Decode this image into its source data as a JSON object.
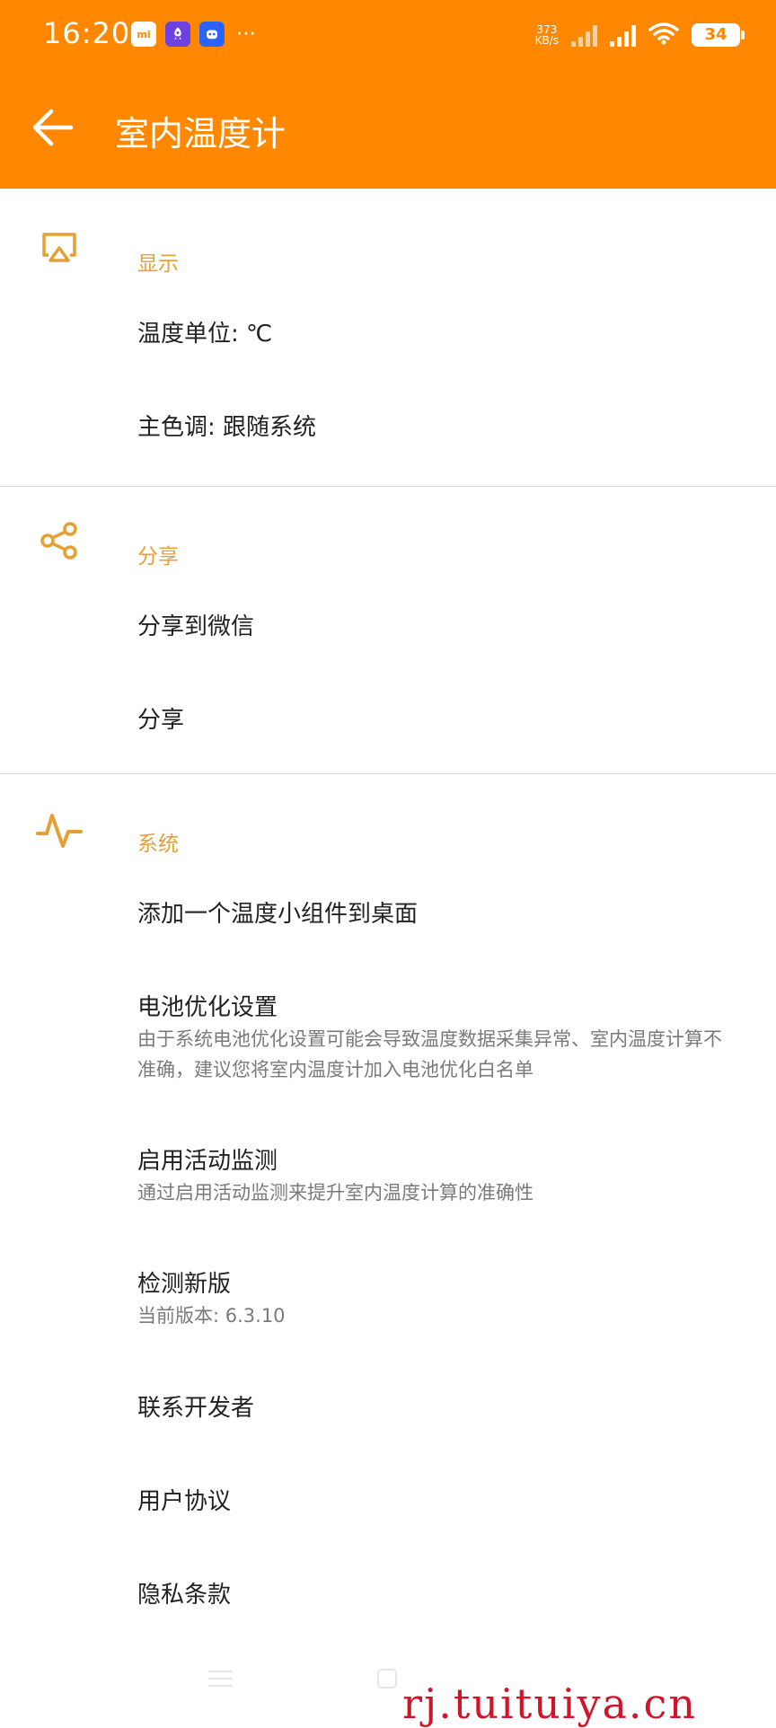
{
  "status_bar": {
    "time": "16:20",
    "netspeed_value": "373",
    "netspeed_unit": "KB/s",
    "battery": "34"
  },
  "toolbar": {
    "title": "室内温度计"
  },
  "sections": [
    {
      "title": "显示",
      "icon": "cast-icon",
      "items": [
        {
          "title": "温度单位: ℃"
        },
        {
          "title": "主色调: 跟随系统"
        }
      ]
    },
    {
      "title": "分享",
      "icon": "share-icon",
      "items": [
        {
          "title": "分享到微信"
        },
        {
          "title": "分享"
        }
      ]
    },
    {
      "title": "系统",
      "icon": "activity-icon",
      "items": [
        {
          "title": "添加一个温度小组件到桌面"
        },
        {
          "title": "电池优化设置",
          "subtitle": "由于系统电池优化设置可能会导致温度数据采集异常、室内温度计算不准确，建议您将室内温度计加入电池优化白名单"
        },
        {
          "title": "启用活动监测",
          "subtitle": "通过启用活动监测来提升室内温度计算的准确性"
        },
        {
          "title": "检测新版",
          "subtitle": "当前版本: 6.3.10"
        },
        {
          "title": "联系开发者"
        },
        {
          "title": "用户协议"
        },
        {
          "title": "隐私条款"
        }
      ]
    }
  ],
  "watermark": "rj.tuituiya.cn",
  "colors": {
    "primary": "#FF8800",
    "section_title": "#E5A035",
    "divider": "#dcdcdc"
  }
}
